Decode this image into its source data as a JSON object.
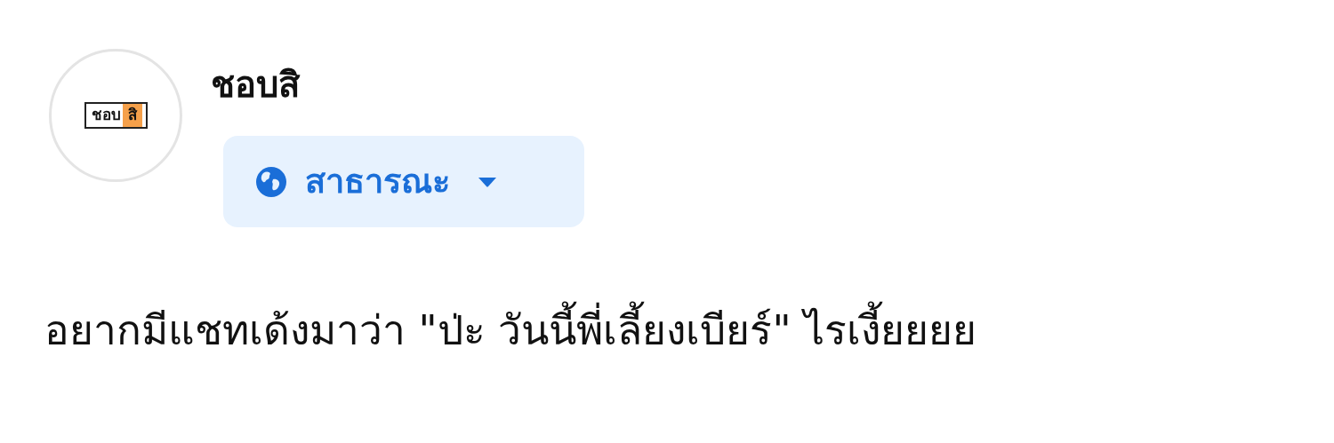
{
  "profile": {
    "logo": {
      "text": "ชอบ",
      "highlight": "สิ"
    },
    "name": "ชอบสิ"
  },
  "audience": {
    "label": "สาธารณะ"
  },
  "post": {
    "text": "อยากมีแชทเด้งมาว่า \"ป่ะ วันนี้พี่เลี้ยงเบียร์\" ไรเงี้ยยยย"
  }
}
